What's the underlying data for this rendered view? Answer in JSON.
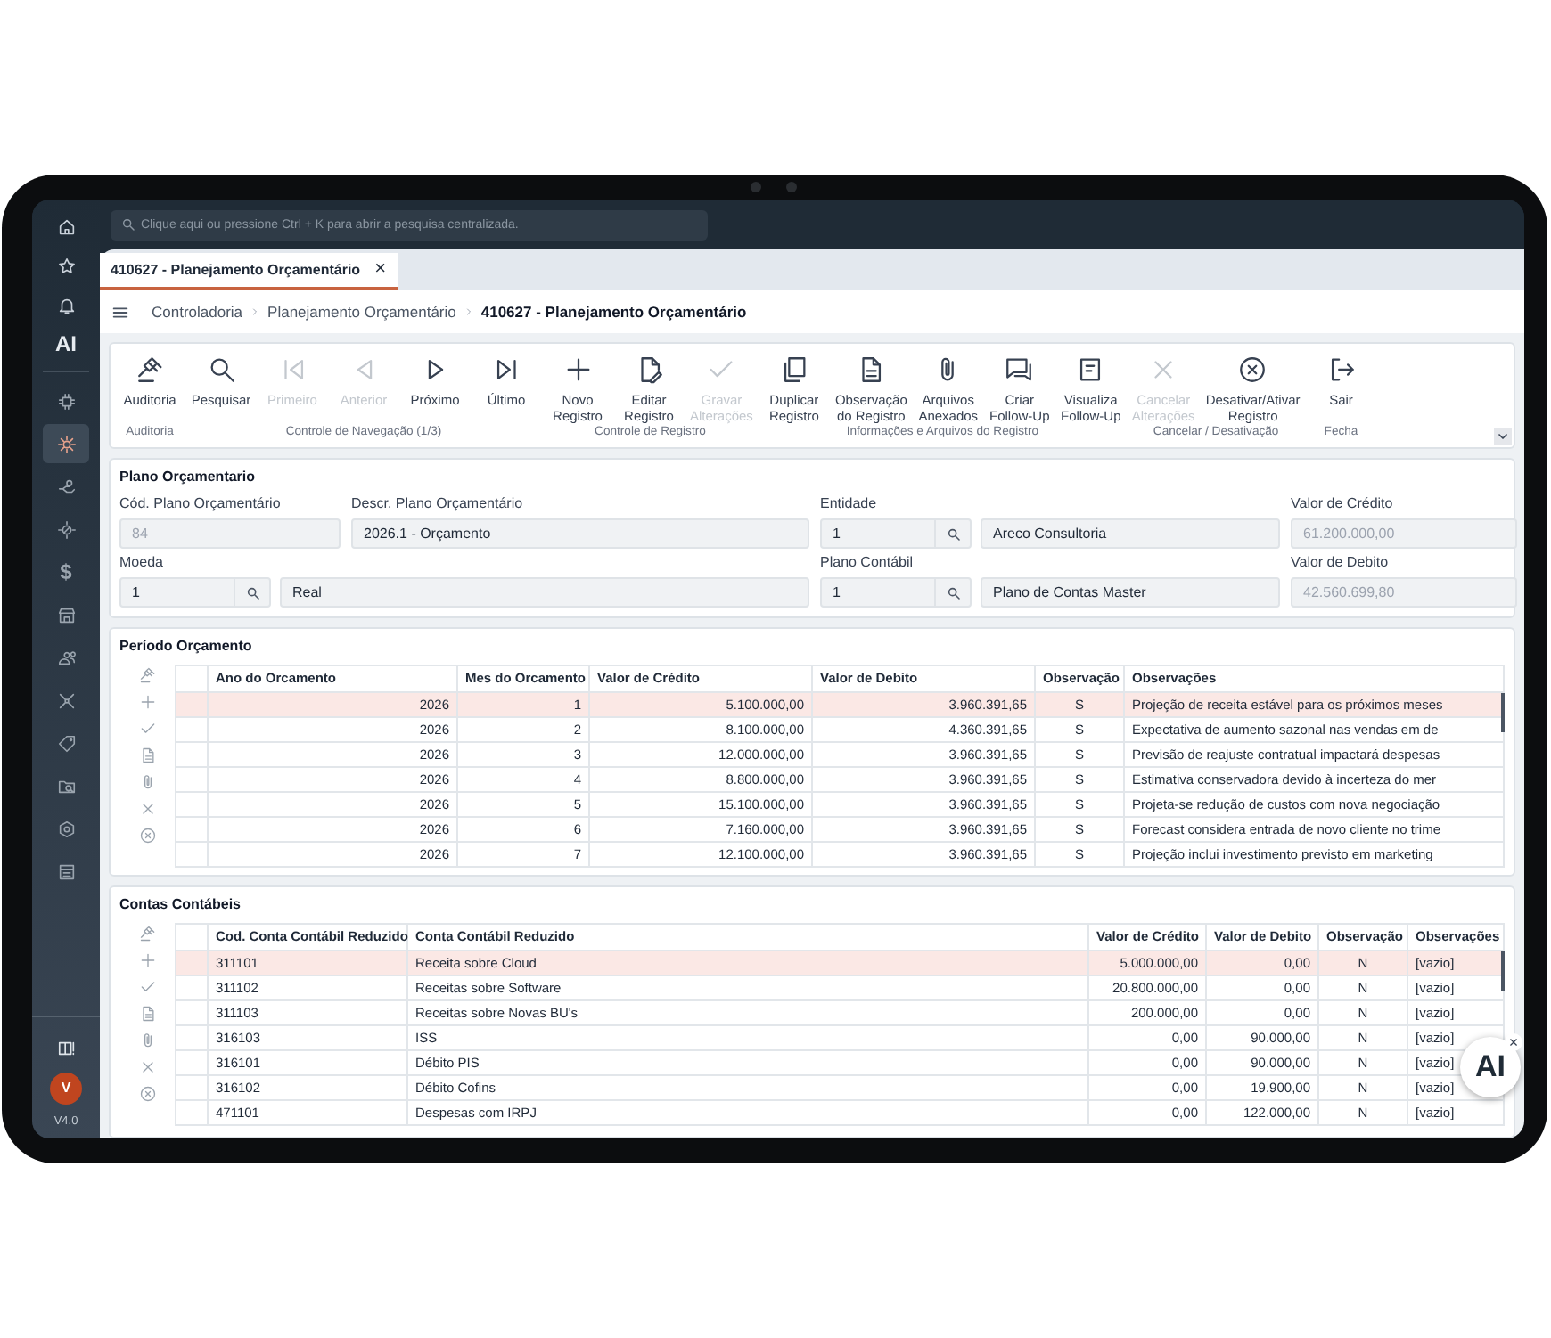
{
  "search": {
    "placeholder": "Clique aqui ou pressione Ctrl + K para abrir a pesquisa centralizada."
  },
  "sidebar": {
    "top_items": [
      {
        "kind": "icon"
      },
      {
        "kind": "icon"
      },
      {
        "kind": "icon"
      },
      {
        "kind": "text",
        "label": "AI"
      }
    ],
    "modules": [
      {
        "kind": "icon",
        "selected": false
      },
      {
        "kind": "icon",
        "selected": true
      },
      {
        "kind": "icon",
        "selected": false
      },
      {
        "kind": "icon",
        "selected": false
      },
      {
        "kind": "text",
        "label": "$",
        "selected": false
      },
      {
        "kind": "icon",
        "selected": false
      },
      {
        "kind": "icon",
        "selected": false
      },
      {
        "kind": "icon",
        "selected": false
      },
      {
        "kind": "icon",
        "selected": false
      },
      {
        "kind": "icon",
        "selected": false
      },
      {
        "kind": "icon",
        "selected": false
      },
      {
        "kind": "icon",
        "selected": false
      }
    ],
    "user_initial": "V",
    "version": "V4.0"
  },
  "tabs": [
    {
      "label": "410627 - Planejamento Orçamentário",
      "close": "×",
      "selected": true
    }
  ],
  "breadcrumb": [
    {
      "label": "Controladoria",
      "current": false
    },
    {
      "label": "Planejamento Orçamentário",
      "current": false
    },
    {
      "label": "410627 - Planejamento Orçamentário",
      "current": true
    }
  ],
  "toolbar": {
    "groups": [
      {
        "label": "Auditoria",
        "buttons": [
          {
            "label": "Auditoria",
            "disabled": false
          }
        ]
      },
      {
        "label": "Controle de Navegação (1/3)",
        "buttons": [
          {
            "label": "Pesquisar",
            "disabled": false
          },
          {
            "label": "Primeiro",
            "disabled": true
          },
          {
            "label": "Anterior",
            "disabled": true
          },
          {
            "label": "Próximo",
            "disabled": false
          },
          {
            "label": "Último",
            "disabled": false
          }
        ]
      },
      {
        "label": "Controle de Registro",
        "buttons": [
          {
            "label": "Novo\nRegistro",
            "disabled": false
          },
          {
            "label": "Editar\nRegistro",
            "disabled": false
          },
          {
            "label": "Gravar\nAlterações",
            "disabled": true
          }
        ]
      },
      {
        "label": "Informações e Arquivos do Registro",
        "buttons": [
          {
            "label": "Duplicar\nRegistro",
            "disabled": false
          },
          {
            "label": "Observação\ndo Registro",
            "disabled": false
          },
          {
            "label": "Arquivos\nAnexados",
            "disabled": false
          },
          {
            "label": "Criar\nFollow-Up",
            "disabled": false
          },
          {
            "label": "Visualiza\nFollow-Up",
            "disabled": false
          }
        ]
      },
      {
        "label": "Cancelar / Desativação",
        "buttons": [
          {
            "label": "Cancelar\nAlterações",
            "disabled": true
          },
          {
            "label": "Desativar/Ativar\nRegistro",
            "disabled": false
          }
        ]
      },
      {
        "label": "Fecha",
        "buttons": [
          {
            "label": "Sair",
            "disabled": false
          }
        ]
      }
    ]
  },
  "form": {
    "title": "Plano Orçamentario",
    "fields": [
      {
        "label": "Cód. Plano Orçamentário",
        "kind": "text",
        "value": "84",
        "disabled": true
      },
      {
        "label": "Descr. Plano Orçamentário",
        "kind": "text",
        "value": "2026.1 - Orçamento",
        "disabled": false
      },
      {
        "label": "Entidade",
        "kind": "lookup",
        "code": "1",
        "value": "Areco Consultoria",
        "disabled": false
      },
      {
        "label": "Valor de Crédito",
        "kind": "text",
        "value": "61.200.000,00",
        "disabled": true
      },
      {
        "label": "Moeda",
        "kind": "lookup",
        "code": "1",
        "value": "Real",
        "disabled": false
      },
      {
        "label": "Plano Contábil",
        "kind": "lookup",
        "code": "1",
        "value": "Plano de Contas Master",
        "disabled": false
      },
      {
        "label": "Valor de Debito",
        "kind": "text",
        "value": "42.560.699,80",
        "disabled": true
      }
    ]
  },
  "period": {
    "title": "Período Orçamento",
    "columns": [
      {
        "label": "Ano do Orcamento",
        "kind": "number"
      },
      {
        "label": "Mes do Orcamento",
        "kind": "number"
      },
      {
        "label": "Valor de Crédito",
        "kind": "number"
      },
      {
        "label": "Valor de Debito",
        "kind": "number"
      },
      {
        "label": "Observação",
        "kind": "flag"
      },
      {
        "label": "Observações",
        "kind": "text"
      }
    ],
    "rows": [
      {
        "selected": true,
        "cells": [
          "2026",
          "1",
          "5.100.000,00",
          "3.960.391,65",
          "S",
          "Projeção de receita estável para os próximos meses"
        ]
      },
      {
        "selected": false,
        "cells": [
          "2026",
          "2",
          "8.100.000,00",
          "4.360.391,65",
          "S",
          "Expectativa de aumento sazonal nas vendas em de"
        ]
      },
      {
        "selected": false,
        "cells": [
          "2026",
          "3",
          "12.000.000,00",
          "3.960.391,65",
          "S",
          "Previsão de reajuste contratual impactará despesas"
        ]
      },
      {
        "selected": false,
        "cells": [
          "2026",
          "4",
          "8.800.000,00",
          "3.960.391,65",
          "S",
          "Estimativa conservadora devido à incerteza do mer"
        ]
      },
      {
        "selected": false,
        "cells": [
          "2026",
          "5",
          "15.100.000,00",
          "3.960.391,65",
          "S",
          "Projeta-se redução de custos com nova negociação"
        ]
      },
      {
        "selected": false,
        "cells": [
          "2026",
          "6",
          "7.160.000,00",
          "3.960.391,65",
          "S",
          "Forecast considera entrada de novo cliente no trime"
        ]
      },
      {
        "selected": false,
        "cells": [
          "2026",
          "7",
          "12.100.000,00",
          "3.960.391,65",
          "S",
          "Projeção inclui investimento previsto em marketing"
        ]
      }
    ]
  },
  "accounts": {
    "title": "Contas Contábeis",
    "columns": [
      {
        "label": "Cod. Conta Contábil Reduzido",
        "kind": "text"
      },
      {
        "label": "Conta Contábil Reduzido",
        "kind": "text"
      },
      {
        "label": "Valor de Crédito",
        "kind": "number"
      },
      {
        "label": "Valor de Debito",
        "kind": "number"
      },
      {
        "label": "Observação",
        "kind": "flag"
      },
      {
        "label": "Observações",
        "kind": "text"
      }
    ],
    "rows": [
      {
        "selected": true,
        "cells": [
          "311101",
          "Receita sobre Cloud",
          "5.000.000,00",
          "0,00",
          "N",
          "[vazio]"
        ]
      },
      {
        "selected": false,
        "cells": [
          "311102",
          "Receitas sobre Software",
          "20.800.000,00",
          "0,00",
          "N",
          "[vazio]"
        ]
      },
      {
        "selected": false,
        "cells": [
          "311103",
          "Receitas sobre Novas BU's",
          "200.000,00",
          "0,00",
          "N",
          "[vazio]"
        ]
      },
      {
        "selected": false,
        "cells": [
          "316103",
          "ISS",
          "0,00",
          "90.000,00",
          "N",
          "[vazio]"
        ]
      },
      {
        "selected": false,
        "cells": [
          "316101",
          "Débito PIS",
          "0,00",
          "90.000,00",
          "N",
          "[vazio]"
        ]
      },
      {
        "selected": false,
        "cells": [
          "316102",
          "Débito Cofins",
          "0,00",
          "19.900,00",
          "N",
          "[vazio]"
        ]
      },
      {
        "selected": false,
        "cells": [
          "471101",
          "Despesas com IRPJ",
          "0,00",
          "122.000,00",
          "N",
          "[vazio]"
        ]
      }
    ]
  },
  "ai_button": {
    "label": "AI",
    "close": "×"
  }
}
